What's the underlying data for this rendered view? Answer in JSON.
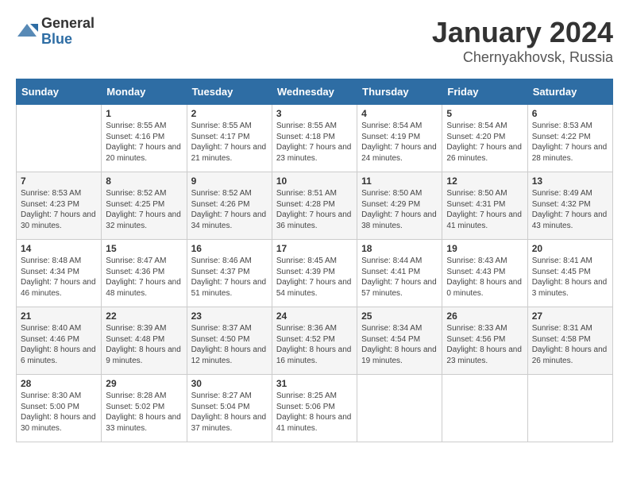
{
  "logo": {
    "general": "General",
    "blue": "Blue"
  },
  "header": {
    "month": "January 2024",
    "location": "Chernyakhovsk, Russia"
  },
  "weekdays": [
    "Sunday",
    "Monday",
    "Tuesday",
    "Wednesday",
    "Thursday",
    "Friday",
    "Saturday"
  ],
  "weeks": [
    [
      {
        "day": "",
        "sunrise": "",
        "sunset": "",
        "daylight": ""
      },
      {
        "day": "1",
        "sunrise": "Sunrise: 8:55 AM",
        "sunset": "Sunset: 4:16 PM",
        "daylight": "Daylight: 7 hours and 20 minutes."
      },
      {
        "day": "2",
        "sunrise": "Sunrise: 8:55 AM",
        "sunset": "Sunset: 4:17 PM",
        "daylight": "Daylight: 7 hours and 21 minutes."
      },
      {
        "day": "3",
        "sunrise": "Sunrise: 8:55 AM",
        "sunset": "Sunset: 4:18 PM",
        "daylight": "Daylight: 7 hours and 23 minutes."
      },
      {
        "day": "4",
        "sunrise": "Sunrise: 8:54 AM",
        "sunset": "Sunset: 4:19 PM",
        "daylight": "Daylight: 7 hours and 24 minutes."
      },
      {
        "day": "5",
        "sunrise": "Sunrise: 8:54 AM",
        "sunset": "Sunset: 4:20 PM",
        "daylight": "Daylight: 7 hours and 26 minutes."
      },
      {
        "day": "6",
        "sunrise": "Sunrise: 8:53 AM",
        "sunset": "Sunset: 4:22 PM",
        "daylight": "Daylight: 7 hours and 28 minutes."
      }
    ],
    [
      {
        "day": "7",
        "sunrise": "Sunrise: 8:53 AM",
        "sunset": "Sunset: 4:23 PM",
        "daylight": "Daylight: 7 hours and 30 minutes."
      },
      {
        "day": "8",
        "sunrise": "Sunrise: 8:52 AM",
        "sunset": "Sunset: 4:25 PM",
        "daylight": "Daylight: 7 hours and 32 minutes."
      },
      {
        "day": "9",
        "sunrise": "Sunrise: 8:52 AM",
        "sunset": "Sunset: 4:26 PM",
        "daylight": "Daylight: 7 hours and 34 minutes."
      },
      {
        "day": "10",
        "sunrise": "Sunrise: 8:51 AM",
        "sunset": "Sunset: 4:28 PM",
        "daylight": "Daylight: 7 hours and 36 minutes."
      },
      {
        "day": "11",
        "sunrise": "Sunrise: 8:50 AM",
        "sunset": "Sunset: 4:29 PM",
        "daylight": "Daylight: 7 hours and 38 minutes."
      },
      {
        "day": "12",
        "sunrise": "Sunrise: 8:50 AM",
        "sunset": "Sunset: 4:31 PM",
        "daylight": "Daylight: 7 hours and 41 minutes."
      },
      {
        "day": "13",
        "sunrise": "Sunrise: 8:49 AM",
        "sunset": "Sunset: 4:32 PM",
        "daylight": "Daylight: 7 hours and 43 minutes."
      }
    ],
    [
      {
        "day": "14",
        "sunrise": "Sunrise: 8:48 AM",
        "sunset": "Sunset: 4:34 PM",
        "daylight": "Daylight: 7 hours and 46 minutes."
      },
      {
        "day": "15",
        "sunrise": "Sunrise: 8:47 AM",
        "sunset": "Sunset: 4:36 PM",
        "daylight": "Daylight: 7 hours and 48 minutes."
      },
      {
        "day": "16",
        "sunrise": "Sunrise: 8:46 AM",
        "sunset": "Sunset: 4:37 PM",
        "daylight": "Daylight: 7 hours and 51 minutes."
      },
      {
        "day": "17",
        "sunrise": "Sunrise: 8:45 AM",
        "sunset": "Sunset: 4:39 PM",
        "daylight": "Daylight: 7 hours and 54 minutes."
      },
      {
        "day": "18",
        "sunrise": "Sunrise: 8:44 AM",
        "sunset": "Sunset: 4:41 PM",
        "daylight": "Daylight: 7 hours and 57 minutes."
      },
      {
        "day": "19",
        "sunrise": "Sunrise: 8:43 AM",
        "sunset": "Sunset: 4:43 PM",
        "daylight": "Daylight: 8 hours and 0 minutes."
      },
      {
        "day": "20",
        "sunrise": "Sunrise: 8:41 AM",
        "sunset": "Sunset: 4:45 PM",
        "daylight": "Daylight: 8 hours and 3 minutes."
      }
    ],
    [
      {
        "day": "21",
        "sunrise": "Sunrise: 8:40 AM",
        "sunset": "Sunset: 4:46 PM",
        "daylight": "Daylight: 8 hours and 6 minutes."
      },
      {
        "day": "22",
        "sunrise": "Sunrise: 8:39 AM",
        "sunset": "Sunset: 4:48 PM",
        "daylight": "Daylight: 8 hours and 9 minutes."
      },
      {
        "day": "23",
        "sunrise": "Sunrise: 8:37 AM",
        "sunset": "Sunset: 4:50 PM",
        "daylight": "Daylight: 8 hours and 12 minutes."
      },
      {
        "day": "24",
        "sunrise": "Sunrise: 8:36 AM",
        "sunset": "Sunset: 4:52 PM",
        "daylight": "Daylight: 8 hours and 16 minutes."
      },
      {
        "day": "25",
        "sunrise": "Sunrise: 8:34 AM",
        "sunset": "Sunset: 4:54 PM",
        "daylight": "Daylight: 8 hours and 19 minutes."
      },
      {
        "day": "26",
        "sunrise": "Sunrise: 8:33 AM",
        "sunset": "Sunset: 4:56 PM",
        "daylight": "Daylight: 8 hours and 23 minutes."
      },
      {
        "day": "27",
        "sunrise": "Sunrise: 8:31 AM",
        "sunset": "Sunset: 4:58 PM",
        "daylight": "Daylight: 8 hours and 26 minutes."
      }
    ],
    [
      {
        "day": "28",
        "sunrise": "Sunrise: 8:30 AM",
        "sunset": "Sunset: 5:00 PM",
        "daylight": "Daylight: 8 hours and 30 minutes."
      },
      {
        "day": "29",
        "sunrise": "Sunrise: 8:28 AM",
        "sunset": "Sunset: 5:02 PM",
        "daylight": "Daylight: 8 hours and 33 minutes."
      },
      {
        "day": "30",
        "sunrise": "Sunrise: 8:27 AM",
        "sunset": "Sunset: 5:04 PM",
        "daylight": "Daylight: 8 hours and 37 minutes."
      },
      {
        "day": "31",
        "sunrise": "Sunrise: 8:25 AM",
        "sunset": "Sunset: 5:06 PM",
        "daylight": "Daylight: 8 hours and 41 minutes."
      },
      {
        "day": "",
        "sunrise": "",
        "sunset": "",
        "daylight": ""
      },
      {
        "day": "",
        "sunrise": "",
        "sunset": "",
        "daylight": ""
      },
      {
        "day": "",
        "sunrise": "",
        "sunset": "",
        "daylight": ""
      }
    ]
  ]
}
